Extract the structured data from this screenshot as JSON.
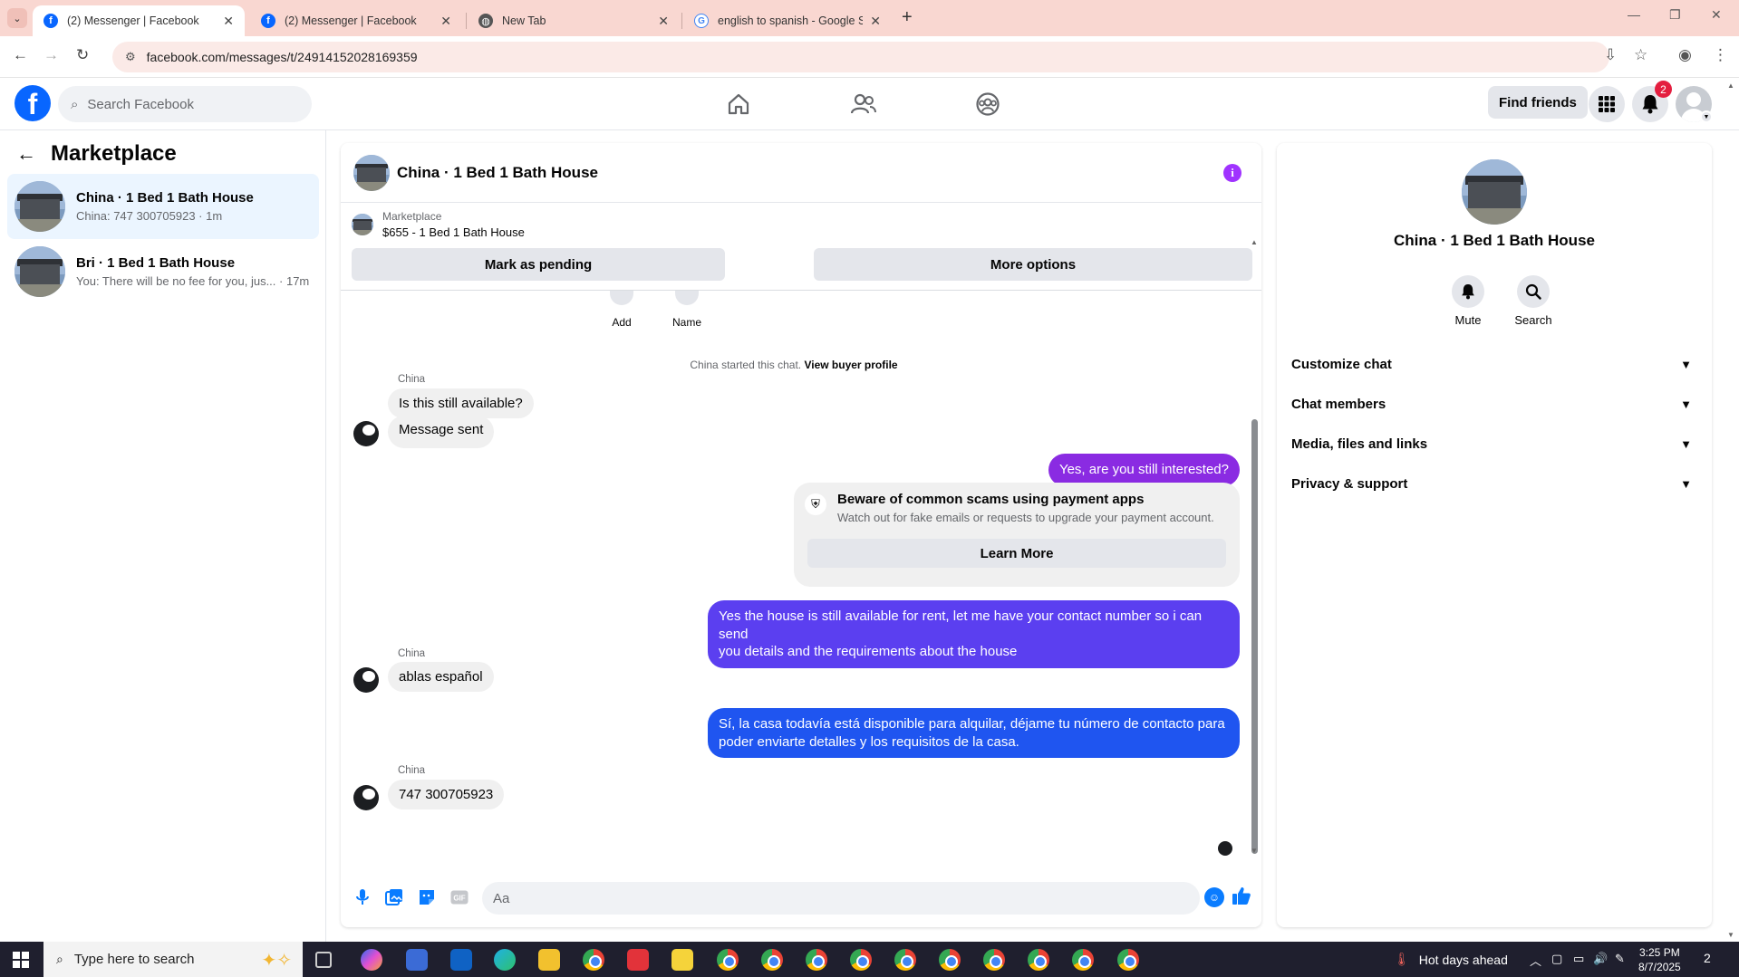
{
  "browser": {
    "tabs": [
      {
        "title": "(2) Messenger | Facebook",
        "favicon": "facebook-icon",
        "active": true
      },
      {
        "title": "(2) Messenger | Facebook",
        "favicon": "facebook-icon",
        "active": false
      },
      {
        "title": "New Tab",
        "favicon": "globe-icon",
        "active": false
      },
      {
        "title": "english to spanish - Google Sea",
        "favicon": "google-icon",
        "active": false
      }
    ],
    "url": "facebook.com/messages/t/24914152028169359"
  },
  "fb_header": {
    "search_placeholder": "Search Facebook",
    "find_friends_label": "Find friends",
    "notification_count": "2"
  },
  "sidebar": {
    "title": "Marketplace",
    "conversations": [
      {
        "name": "China · 1 Bed 1 Bath House",
        "preview": "China: 747 300705923 · 1m",
        "active": true
      },
      {
        "name": "Bri · 1 Bed 1 Bath House",
        "preview": "You: There will be no fee for you, jus... · 17m",
        "active": false
      }
    ]
  },
  "chat": {
    "title": "China · 1 Bed 1 Bath House",
    "listing": {
      "source": "Marketplace",
      "title": "$655 - 1 Bed 1 Bath House"
    },
    "actions": {
      "mark_pending": "Mark as pending",
      "more_options": "More options"
    },
    "mini_actions": {
      "add": "Add",
      "name": "Name"
    },
    "system_text": "China started this chat.",
    "system_link": "View buyer profile",
    "sender_name": "China",
    "messages": {
      "m1": "Is this still available?",
      "m2": "Message sent",
      "m3": "Yes, are you still interested?",
      "m4_line1": "Yes the house is still available for rent, let me have your contact number so i can send",
      "m4_line2": "you details and the requirements about the house",
      "m5": "ablas español",
      "m6_line1": "Sí, la casa todavía está disponible para alquilar, déjame tu número de contacto para",
      "m6_line2": "poder enviarte detalles y los requisitos de la casa.",
      "m7": "747 300705923"
    },
    "scam_notice": {
      "title": "Beware of common scams using payment apps",
      "description": "Watch out for fake emails or requests to upgrade your payment account.",
      "button": "Learn More"
    },
    "composer_placeholder": "Aa",
    "colors": {
      "outgoing_purple": "#8a2be2",
      "outgoing_violet": "#5b3ff0",
      "outgoing_blue": "#1f55f0",
      "incoming": "#f0f0f0"
    }
  },
  "info_panel": {
    "title": "China · 1 Bed 1 Bath House",
    "mute_label": "Mute",
    "search_label": "Search",
    "sections": [
      "Customize chat",
      "Chat members",
      "Media, files and links",
      "Privacy & support"
    ]
  },
  "taskbar": {
    "search_placeholder": "Type here to search",
    "weather": "Hot days ahead",
    "time": "3:25 PM",
    "date": "8/7/2025",
    "notification_count": "2"
  }
}
